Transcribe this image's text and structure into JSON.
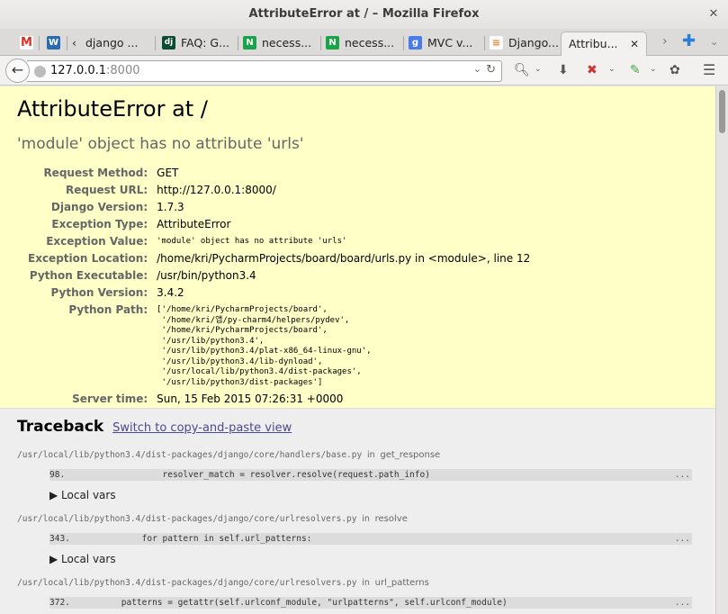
{
  "window": {
    "title": "AttributeError at / – Mozilla Firefox"
  },
  "tabs": [
    {
      "label": "",
      "icon": "gmail-icon",
      "favicon_text": "M",
      "color": "#d93025"
    },
    {
      "label": "",
      "icon": "wordpress-icon",
      "favicon_text": "W",
      "color": "#2b6cb0"
    },
    {
      "label": "django ...",
      "icon": "chevron-left-icon"
    },
    {
      "label": "FAQ: G...",
      "icon": "django-icon",
      "favicon_text": "dj",
      "color": "#0c4b33"
    },
    {
      "label": "necess...",
      "icon": "n-icon",
      "favicon_text": "N",
      "color": "#1aa449"
    },
    {
      "label": "necess...",
      "icon": "n-icon",
      "favicon_text": "N",
      "color": "#1aa449"
    },
    {
      "label": "MVC v...",
      "icon": "google-icon",
      "favicon_text": "g",
      "color": "#4a7be8"
    },
    {
      "label": "Django...",
      "icon": "stackoverflow-icon"
    },
    {
      "label": "Attribu...",
      "icon": "close-icon",
      "active": true
    }
  ],
  "navbar": {
    "url_host": "127.0.0.1",
    "url_port": ":8000"
  },
  "error": {
    "title": "AttributeError at /",
    "subtitle": "'module' object has no attribute 'urls'",
    "meta": [
      {
        "k": "Request Method:",
        "v": "GET"
      },
      {
        "k": "Request URL:",
        "v": "http://127.0.0.1:8000/"
      },
      {
        "k": "Django Version:",
        "v": "1.7.3"
      },
      {
        "k": "Exception Type:",
        "v": "AttributeError"
      },
      {
        "k": "Exception Value:",
        "v": "'module' object has no attribute 'urls'",
        "mono": true
      },
      {
        "k": "Exception Location:",
        "v": "/home/kri/PycharmProjects/board/board/urls.py in <module>, line 12"
      },
      {
        "k": "Python Executable:",
        "v": "/usr/bin/python3.4"
      },
      {
        "k": "Python Version:",
        "v": "3.4.2"
      }
    ],
    "python_path_label": "Python Path:",
    "python_path": [
      "['/home/kri/PycharmProjects/board',",
      " '/home/kri/앱/py-charm4/helpers/pydev',",
      " '/home/kri/PycharmProjects/board',",
      " '/usr/lib/python3.4',",
      " '/usr/lib/python3.4/plat-x86_64-linux-gnu',",
      " '/usr/lib/python3.4/lib-dynload',",
      " '/usr/local/lib/python3.4/dist-packages',",
      " '/usr/lib/python3/dist-packages']"
    ],
    "server_time_label": "Server time:",
    "server_time": "Sun, 15 Feb 2015 07:26:31 +0000"
  },
  "traceback": {
    "title": "Traceback",
    "switch_link": "Switch to copy-and-paste view",
    "in_word": "in",
    "frames": [
      {
        "file": "/usr/local/lib/python3.4/dist-packages/django/core/handlers/base.py",
        "fn": "get_response",
        "line": "98.",
        "code": "                resolver_match = resolver.resolve(request.path_info)",
        "local": "▶ Local vars"
      },
      {
        "file": "/usr/local/lib/python3.4/dist-packages/django/core/urlresolvers.py",
        "fn": "resolve",
        "line": "343.",
        "code": "            for pattern in self.url_patterns:",
        "local": "▶ Local vars"
      },
      {
        "file": "/usr/local/lib/python3.4/dist-packages/django/core/urlresolvers.py",
        "fn": "url_patterns",
        "line": "372.",
        "code": "        patterns = getattr(self.urlconf_module, \"urlpatterns\", self.urlconf_module)",
        "local": ""
      }
    ],
    "dots": "..."
  }
}
